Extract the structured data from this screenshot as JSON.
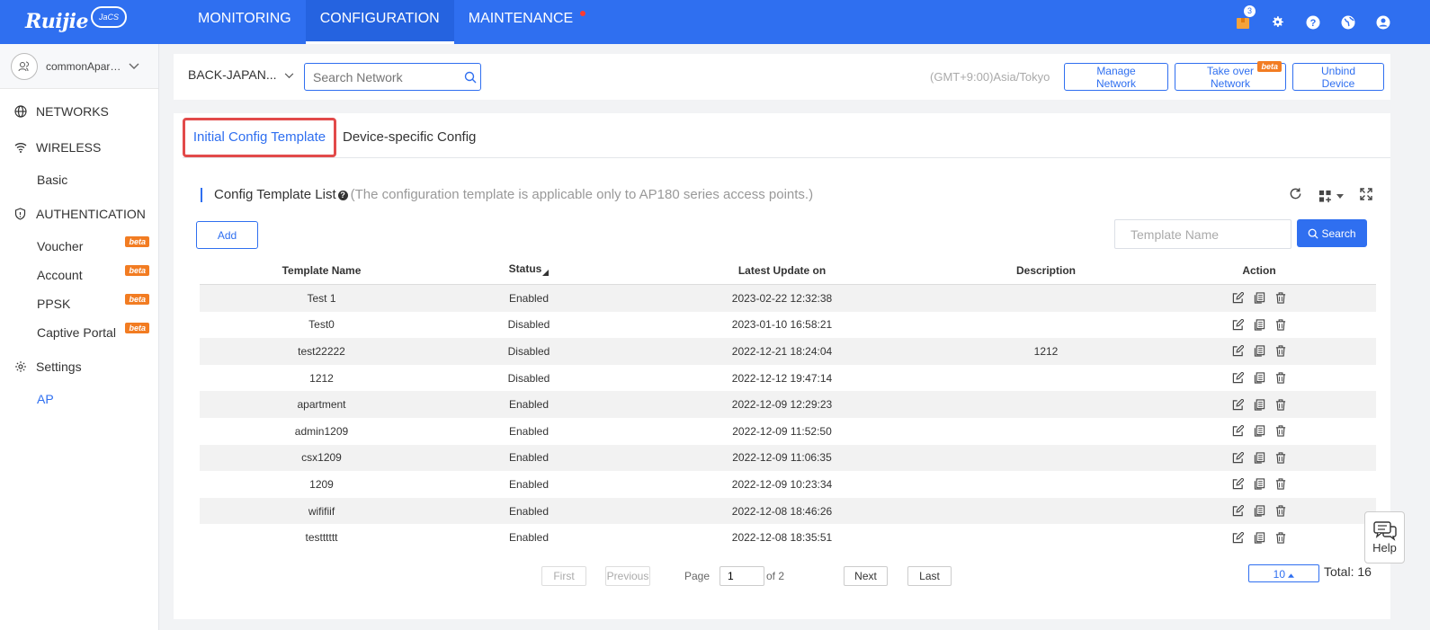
{
  "brand": {
    "logo_text": "Ruijie",
    "logo_sub": "JaCS"
  },
  "nav": [
    {
      "label": "MONITORING"
    },
    {
      "label": "CONFIGURATION"
    },
    {
      "label": "MAINTENANCE"
    }
  ],
  "top_icons": {
    "notifications_count": "3"
  },
  "sidebar": {
    "user": "commonApartment",
    "groups": [
      {
        "label": "NETWORKS",
        "icon": "globe-icon",
        "items": []
      },
      {
        "label": "WIRELESS",
        "icon": "wifi-icon",
        "items": [
          {
            "label": "Basic"
          }
        ]
      },
      {
        "label": "AUTHENTICATION",
        "icon": "shield-icon",
        "items": [
          {
            "label": "Voucher",
            "badge": "beta"
          },
          {
            "label": "Account",
            "badge": "beta"
          },
          {
            "label": "PPSK",
            "badge": "beta"
          },
          {
            "label": "Captive Portal",
            "badge": "beta"
          }
        ]
      },
      {
        "label": "Settings",
        "icon": "gear-icon",
        "items": [
          {
            "label": "AP"
          }
        ]
      }
    ]
  },
  "netbar": {
    "network_name": "BACK-JAPAN...",
    "search_placeholder": "Search Network",
    "timezone": "(GMT+9:00)Asia/Tokyo",
    "buttons": {
      "manage": "Manage Network",
      "takeover": "Take over Network",
      "takeover_badge": "beta",
      "unbind": "Unbind Device"
    }
  },
  "tabs": {
    "initial": "Initial Config Template",
    "device": "Device-specific Config"
  },
  "list": {
    "title": "Config Template List",
    "note": "(The configuration template is applicable only to AP180 series access points.)",
    "add_label": "Add",
    "search_placeholder": "Template Name",
    "search_label": "Search"
  },
  "table": {
    "columns": [
      "Template Name",
      "Status",
      "Latest Update on",
      "Description",
      "Action"
    ],
    "rows": [
      {
        "name": "Test 1",
        "status": "Enabled",
        "updated": "2023-02-22 12:32:38",
        "description": ""
      },
      {
        "name": "Test0",
        "status": "Disabled",
        "updated": "2023-01-10 16:58:21",
        "description": ""
      },
      {
        "name": "test22222",
        "status": "Disabled",
        "updated": "2022-12-21 18:24:04",
        "description": "1212"
      },
      {
        "name": "1212",
        "status": "Disabled",
        "updated": "2022-12-12 19:47:14",
        "description": ""
      },
      {
        "name": "apartment",
        "status": "Enabled",
        "updated": "2022-12-09 12:29:23",
        "description": ""
      },
      {
        "name": "admin1209",
        "status": "Enabled",
        "updated": "2022-12-09 11:52:50",
        "description": ""
      },
      {
        "name": "csx1209",
        "status": "Enabled",
        "updated": "2022-12-09 11:06:35",
        "description": ""
      },
      {
        "name": "1209",
        "status": "Enabled",
        "updated": "2022-12-09 10:23:34",
        "description": ""
      },
      {
        "name": "wififiif",
        "status": "Enabled",
        "updated": "2022-12-08 18:46:26",
        "description": ""
      },
      {
        "name": "testttttt",
        "status": "Enabled",
        "updated": "2022-12-08 18:35:51",
        "description": ""
      }
    ]
  },
  "pagination": {
    "first": "First",
    "previous": "Previous",
    "page_label": "Page",
    "page": "1",
    "of_label": "of 2",
    "next": "Next",
    "last": "Last",
    "per_page": "10",
    "total": "Total: 16"
  },
  "help": {
    "label": "Help"
  },
  "colors": {
    "primary": "#2f6ff0",
    "beta": "#f27c22",
    "highlight_border": "#e24a4a"
  }
}
